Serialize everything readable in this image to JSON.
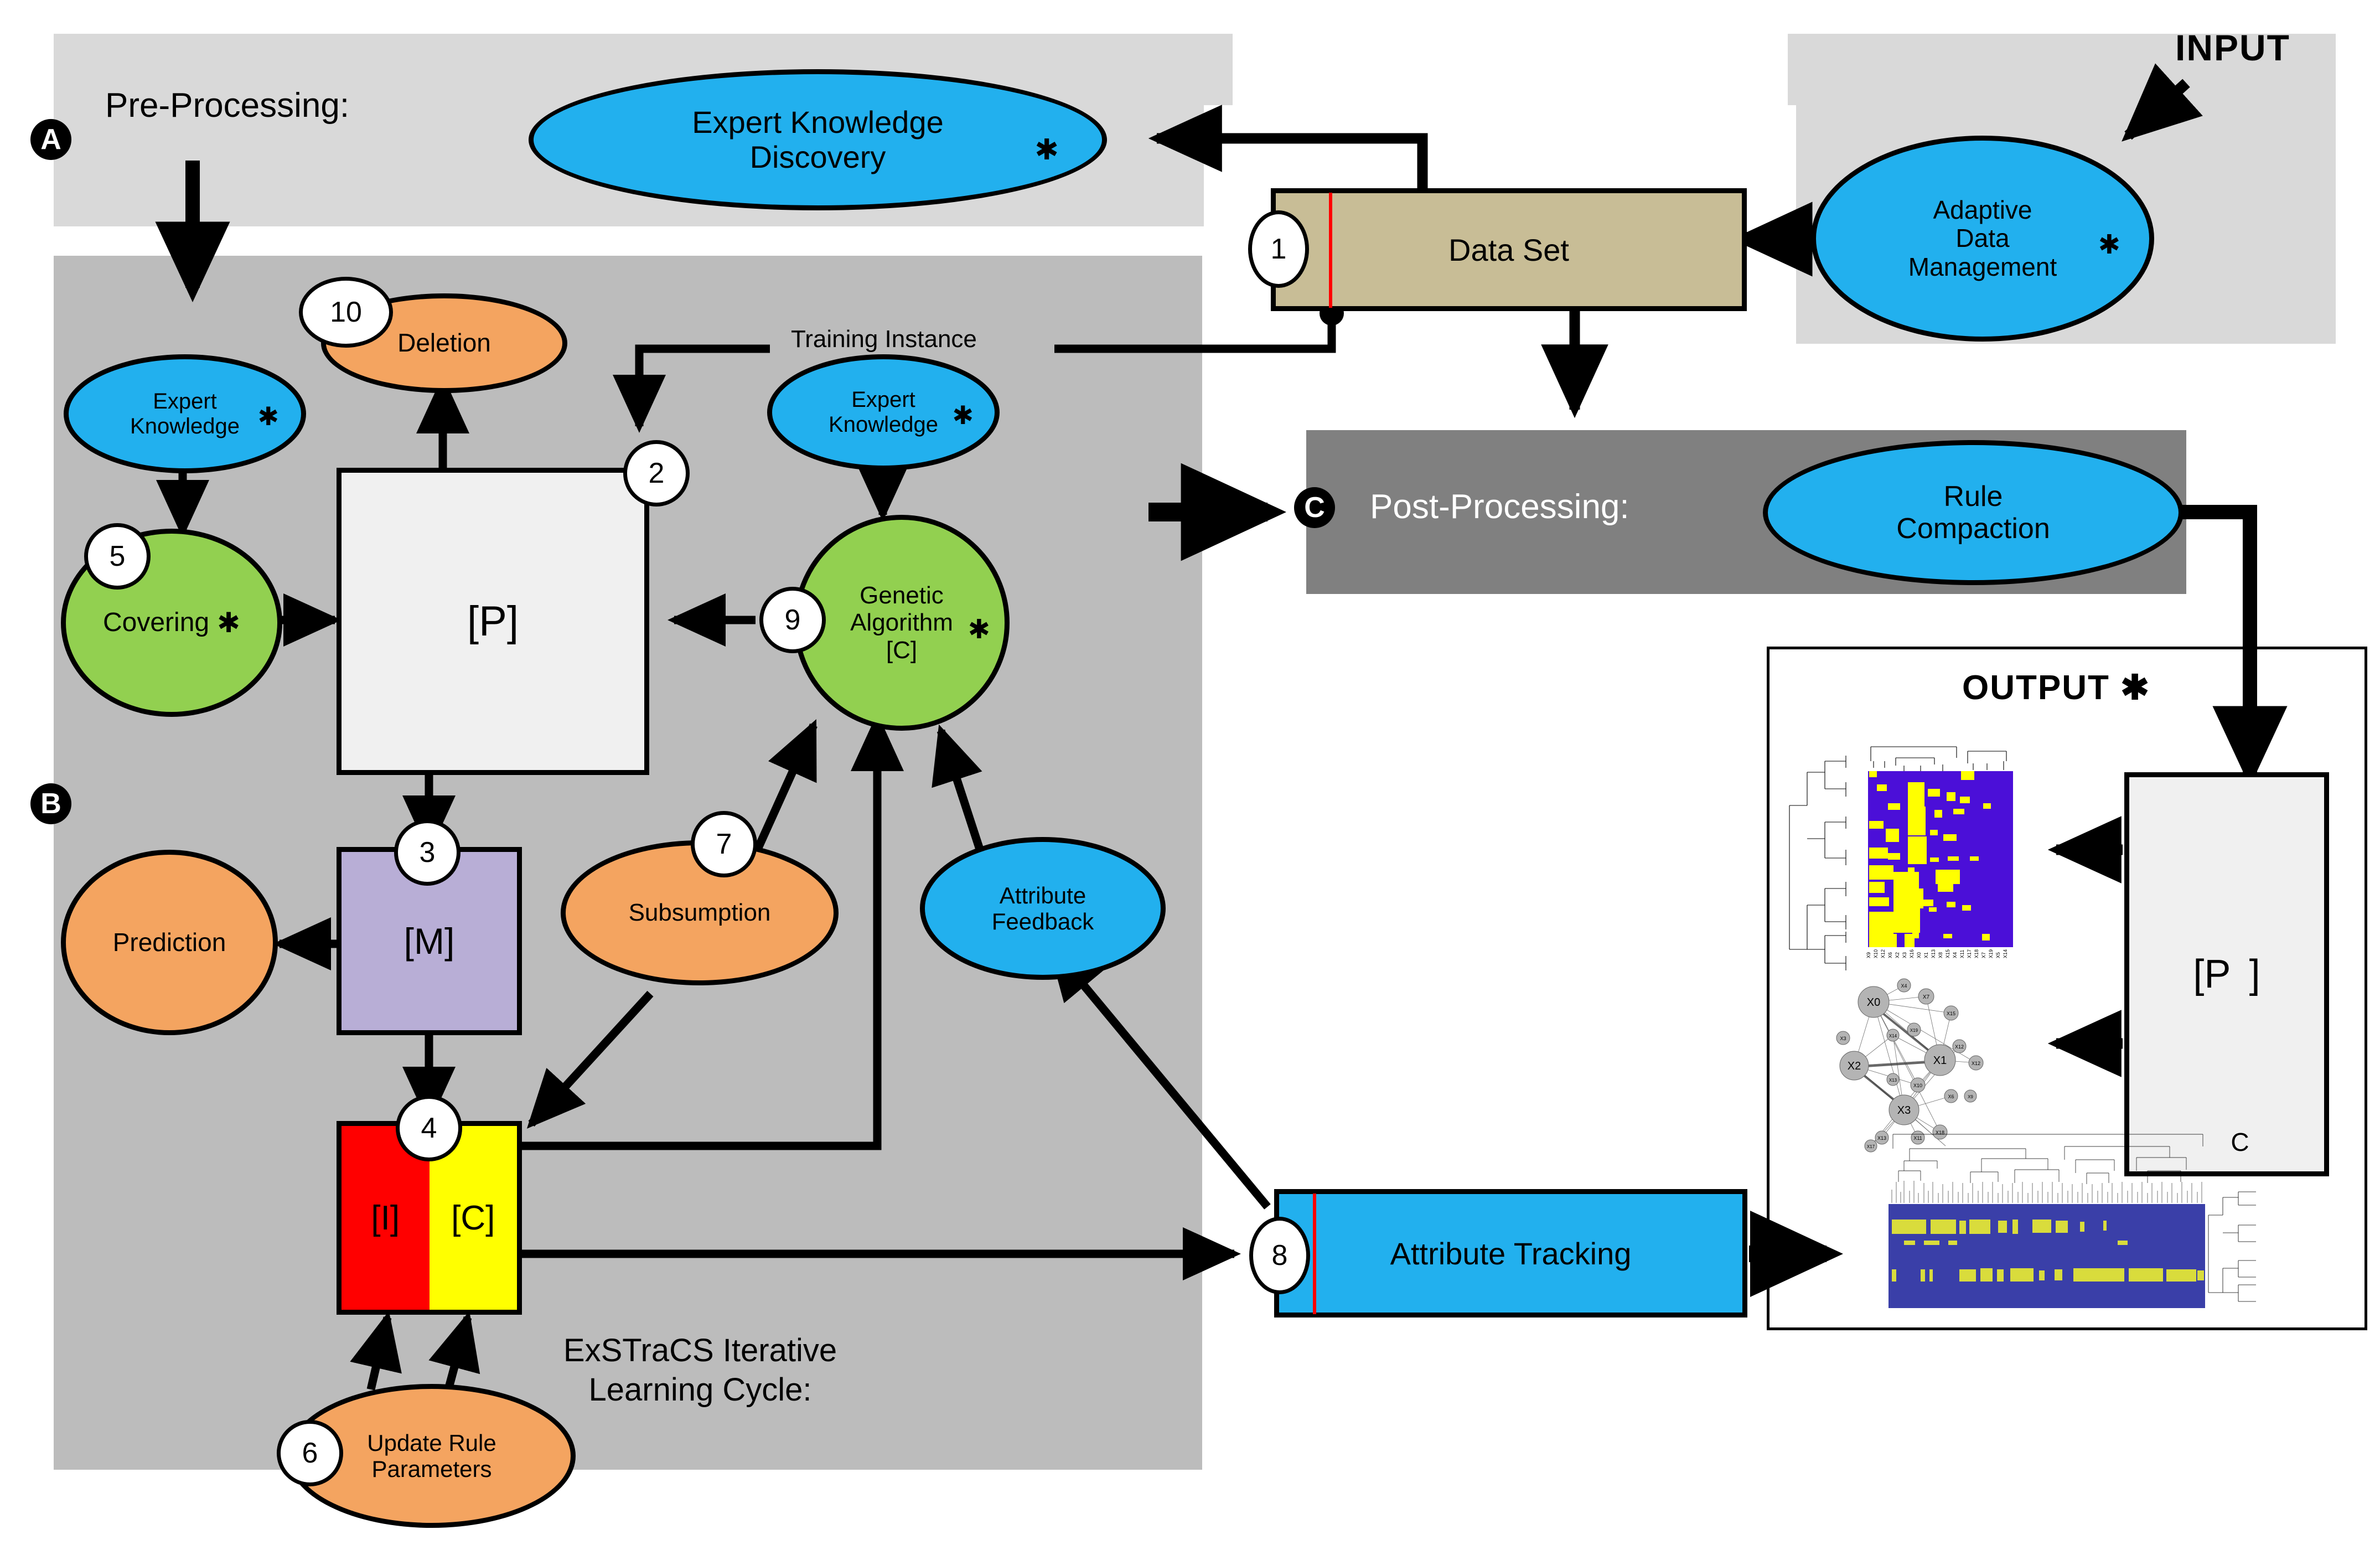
{
  "panels": {
    "preprocessing": {
      "label": "Pre-Processing:",
      "badge": "A"
    },
    "learning": {
      "label": "ExSTraCS Iterative\nLearning Cycle:",
      "badge": "B"
    },
    "postprocessing": {
      "label": "Post-Processing:",
      "badge": "C"
    },
    "input": {
      "label": "INPUT"
    },
    "output": {
      "label": "OUTPUT",
      "star": "✱"
    }
  },
  "edge_labels": {
    "training_instance": "Training Instance"
  },
  "nodes": {
    "expert_knowledge_discovery": {
      "line1": "Expert Knowledge",
      "line2": "Discovery",
      "star": "✱",
      "color": "#22b0ee"
    },
    "adaptive_data_management": {
      "line1": "Adaptive",
      "line2": "Data",
      "line3": "Management",
      "star": "✱",
      "color": "#22b0ee"
    },
    "data_set": {
      "label": "Data Set",
      "step": "1",
      "color": "#c8bd96"
    },
    "expert_knowledge_left": {
      "line1": "Expert",
      "line2": "Knowledge",
      "star": "✱",
      "color": "#22b0ee"
    },
    "deletion": {
      "label": "Deletion",
      "step": "10",
      "color": "#f4a460"
    },
    "covering": {
      "label": "Covering",
      "star": "✱",
      "step": "5",
      "color": "#92d050"
    },
    "population": {
      "label": "[P]",
      "step": "2",
      "color": "#f0f0f0"
    },
    "expert_knowledge_right": {
      "line1": "Expert",
      "line2": "Knowledge",
      "star": "✱",
      "color": "#22b0ee"
    },
    "genetic_algorithm": {
      "line1": "Genetic",
      "line2": "Algorithm",
      "line3": "[C]",
      "star": "✱",
      "step": "9",
      "color": "#92d050"
    },
    "match_set": {
      "label": "[M]",
      "step": "3",
      "color": "#b8aed6"
    },
    "prediction": {
      "label": "Prediction",
      "color": "#f4a460"
    },
    "subsumption": {
      "label": "Subsumption",
      "step": "7",
      "color": "#f4a460"
    },
    "attribute_feedback": {
      "line1": "Attribute",
      "line2": "Feedback",
      "color": "#22b0ee"
    },
    "incorrect_set": {
      "label": "[I]",
      "color": "#ff0000"
    },
    "correct_set": {
      "label": "[C]",
      "color": "#ffff00",
      "step": "4"
    },
    "update_rule_parameters": {
      "line1": "Update Rule",
      "line2": "Parameters",
      "step": "6",
      "color": "#f4a460"
    },
    "attribute_tracking": {
      "label": "Attribute Tracking",
      "step": "8",
      "color": "#22b0ee"
    },
    "rule_compaction": {
      "line1": "Rule",
      "line2": "Compaction",
      "color": "#22b0ee"
    },
    "compacted_population": {
      "label": "[P",
      "sub": "C",
      "label_end": "]",
      "color": "#f0f0f0"
    }
  },
  "output_plots": {
    "heatmap_labels": [
      "X9",
      "X10",
      "X12",
      "X6",
      "X2",
      "X3",
      "X16",
      "X0",
      "X1",
      "X13",
      "X8",
      "X15",
      "X4",
      "X11",
      "X17",
      "X18",
      "X7",
      "X19",
      "X5",
      "X14"
    ],
    "network_nodes": [
      "X0",
      "X1",
      "X2",
      "X3",
      "X4",
      "X7",
      "X15",
      "X3",
      "X19",
      "X14",
      "X12",
      "X10",
      "X13",
      "X6",
      "X9",
      "X17",
      "X13",
      "X11",
      "X18",
      "X0"
    ],
    "colors": {
      "heatmap_low": "#4b0fd8",
      "heatmap_high": "#ffff00",
      "track_low": "#3a3fa8",
      "track_high": "#d9dc3c"
    }
  },
  "accent_colors": {
    "red_marker": "#ff0000",
    "panel_pre": "#d9d9d9",
    "panel_learning": "#bcbcbc",
    "panel_post": "#808080"
  }
}
